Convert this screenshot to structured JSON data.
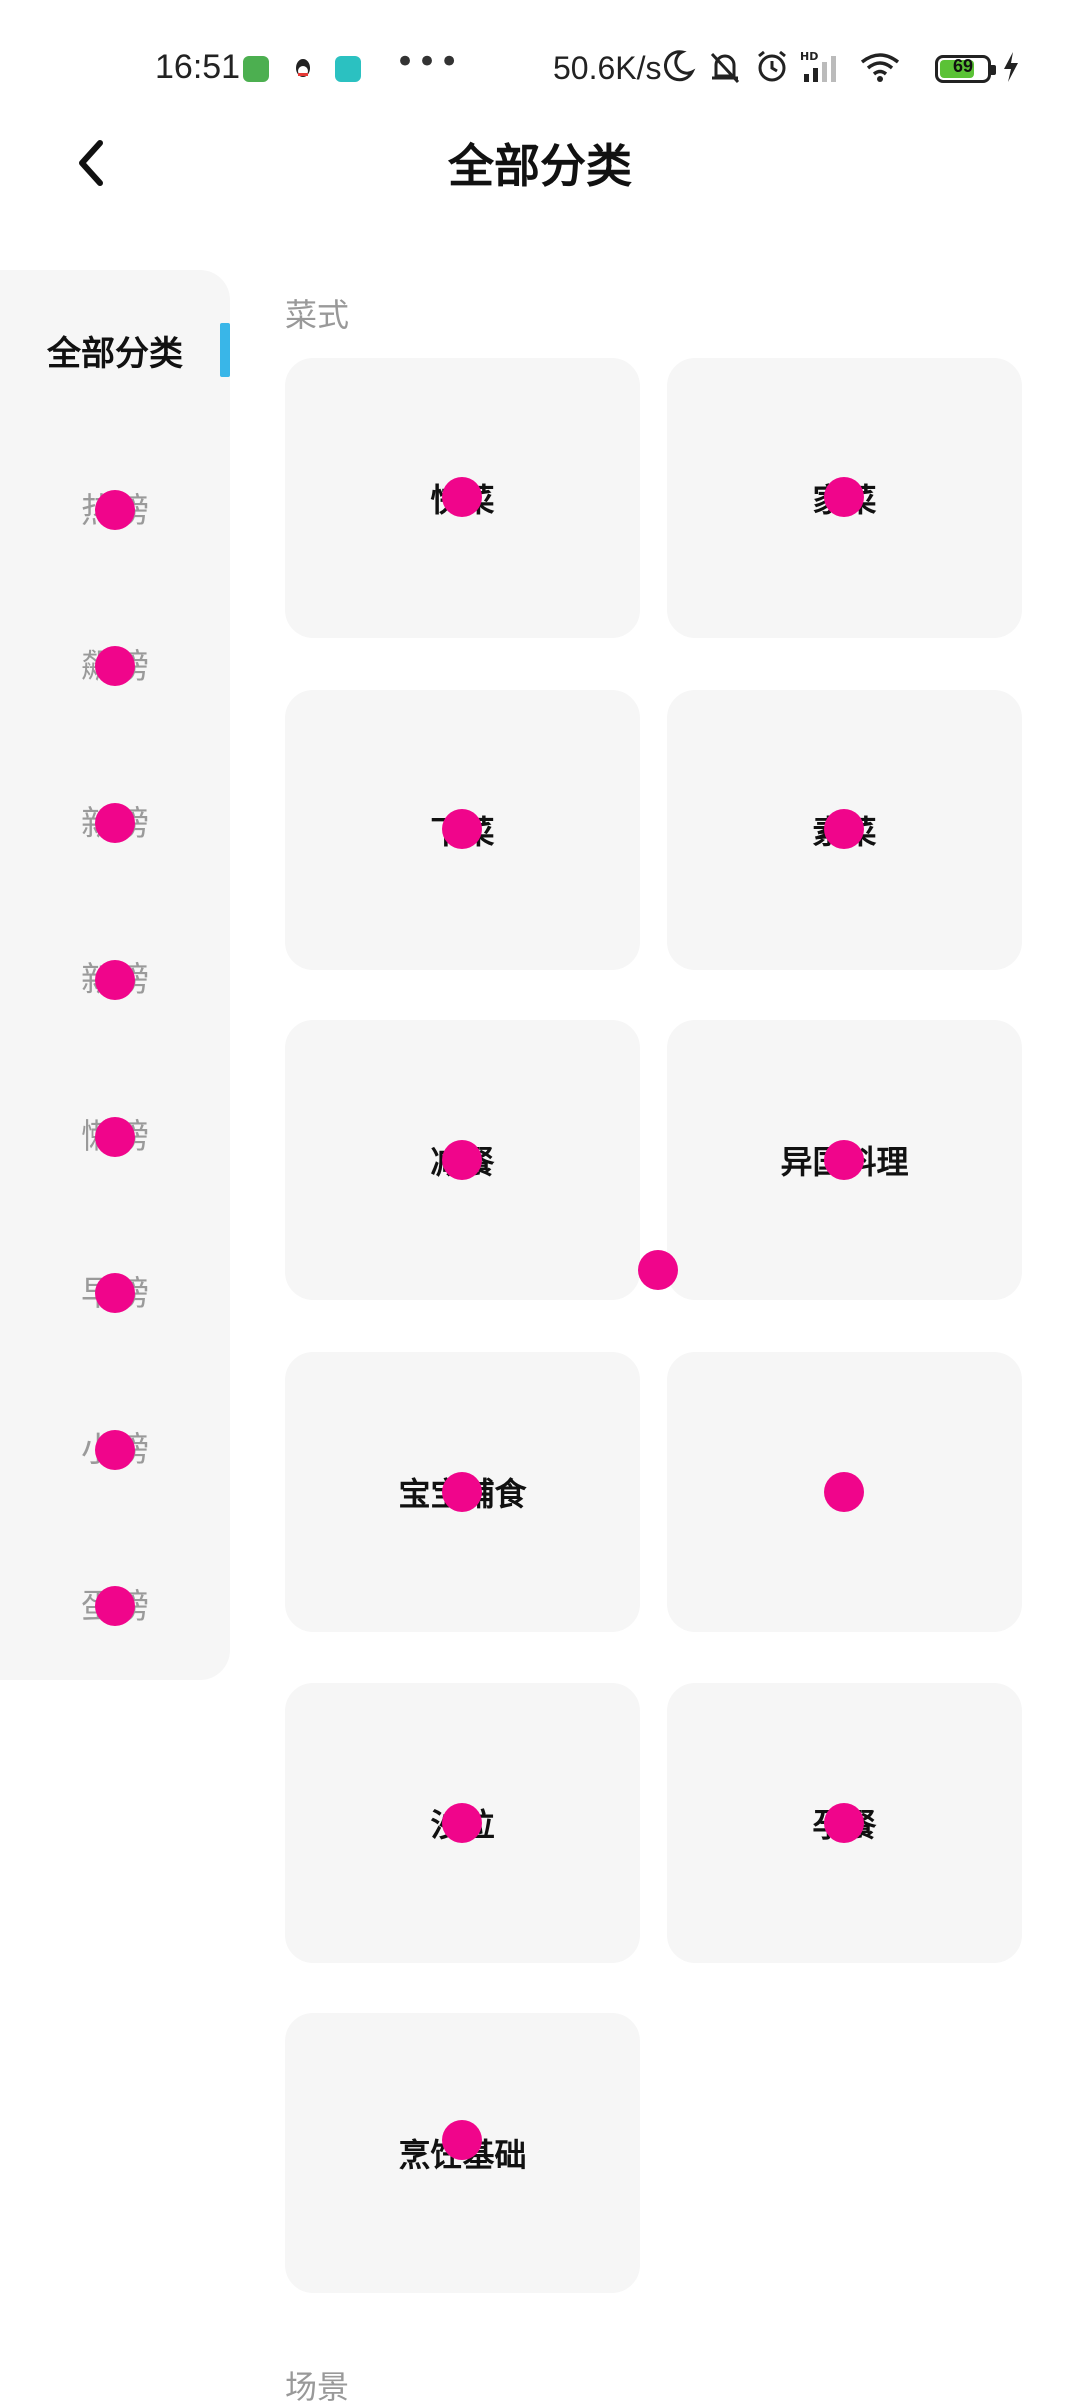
{
  "status_bar": {
    "time": "16:51",
    "network_speed": "50.6K/s",
    "battery_level": "69",
    "icons": [
      "app-green-icon",
      "qq-icon",
      "wechat-icon",
      "more-notifications-icon",
      "moon-icon",
      "bell-off-icon",
      "alarm-icon",
      "hd-signal-icon",
      "wifi-icon",
      "battery-icon",
      "charging-icon"
    ]
  },
  "header": {
    "back_icon": "chevron-left-icon",
    "title": "全部分类"
  },
  "sidebar": {
    "items": [
      {
        "label": "全部分类",
        "active": true
      },
      {
        "label": "热榜",
        "active": false
      },
      {
        "label": "飙榜",
        "active": false
      },
      {
        "label": "新榜",
        "active": false
      },
      {
        "label": "新榜",
        "active": false
      },
      {
        "label": "懒榜",
        "active": false
      },
      {
        "label": "早榜",
        "active": false
      },
      {
        "label": "小榜",
        "active": false
      },
      {
        "label": "蛋榜",
        "active": false
      }
    ],
    "indicator_color": "#39b6e8"
  },
  "sections": [
    {
      "title": "菜式",
      "tiles": [
        {
          "label": "快菜"
        },
        {
          "label": "家菜"
        },
        {
          "label": "下菜"
        },
        {
          "label": "素菜"
        },
        {
          "label": "减餐"
        },
        {
          "label": "异国料理"
        },
        {
          "label": "宝宝辅食"
        },
        {
          "label": ""
        },
        {
          "label": "沙拉"
        },
        {
          "label": "孕餐"
        },
        {
          "label": "烹饪基础"
        }
      ]
    },
    {
      "title": "场景",
      "tiles": []
    }
  ],
  "colors": {
    "tile_bg": "#f6f6f6",
    "marker": "#f0058b",
    "accent": "#39b6e8"
  }
}
